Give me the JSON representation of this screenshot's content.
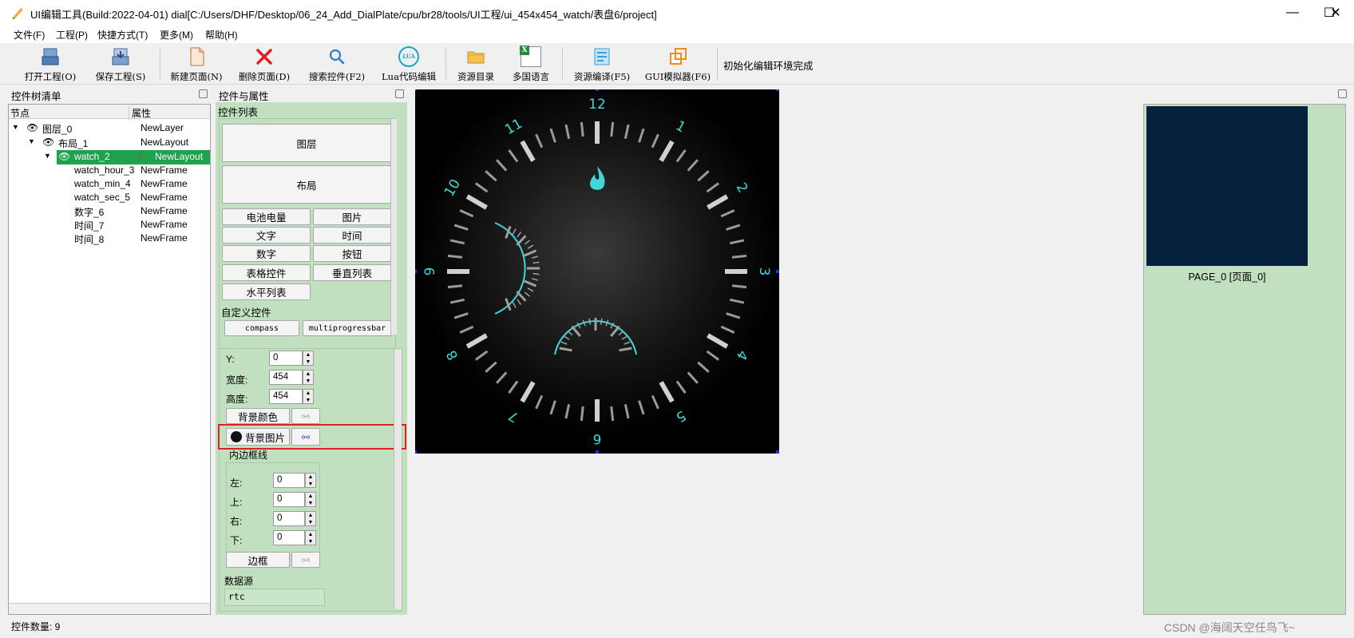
{
  "window": {
    "title": "UI编辑工具(Build:2022-04-01) dial[C:/Users/DHF/Desktop/06_24_Add_DialPlate/cpu/br28/tools/UI工程/ui_454x454_watch/表盘6/project]",
    "minimize": "—",
    "maximize": "☐",
    "close": "✕"
  },
  "menu": [
    "文件(F)",
    "工程(P)",
    "快捷方式(T)",
    "更多(M)",
    "帮助(H)"
  ],
  "toolbar": {
    "open": "打开工程(O)",
    "save": "保存工程(S)",
    "new_page": "新建页面(N)",
    "delete_page": "删除页面(D)",
    "search": "搜索控件(F2)",
    "lua": "Lua代码编辑",
    "res_dir": "资源目录",
    "multi_lang": "多国语言",
    "res_compile": "资源编译(F5)",
    "gui_sim": "GUI模拟器(F6)",
    "status": "初始化编辑环境完成",
    "lua_badge": "LUA",
    "excel_badge": "X"
  },
  "tree": {
    "title": "控件树清单",
    "col_node": "节点",
    "col_attr": "属性",
    "rows": [
      {
        "name": "图层_0",
        "attr": "NewLayer"
      },
      {
        "name": "布局_1",
        "attr": "NewLayout"
      },
      {
        "name": "watch_2",
        "attr": "NewLayout"
      },
      {
        "name": "watch_hour_3",
        "attr": "NewFrame"
      },
      {
        "name": "watch_min_4",
        "attr": "NewFrame"
      },
      {
        "name": "watch_sec_5",
        "attr": "NewFrame"
      },
      {
        "name": "数字_6",
        "attr": "NewFrame"
      },
      {
        "name": "时间_7",
        "attr": "NewFrame"
      },
      {
        "name": "时间_8",
        "attr": "NewFrame"
      }
    ]
  },
  "props": {
    "title": "控件与属性",
    "list_title": "控件列表",
    "btn_layer": "图层",
    "btn_layout": "布局",
    "grid": [
      "电池电量",
      "图片",
      "文字",
      "时间",
      "数字",
      "按钮",
      "表格控件",
      "垂直列表",
      "水平列表"
    ],
    "custom_title": "自定义控件",
    "custom_items": [
      "compass",
      "multiprogressbar"
    ],
    "y_label": "Y:",
    "y_val": "0",
    "w_label": "宽度:",
    "w_val": "454",
    "h_label": "高度:",
    "h_val": "454",
    "bg_color": "背景颜色",
    "bg_image": "背景图片",
    "padding_title": "内边框线",
    "left_label": "左:",
    "left_val": "0",
    "top_label": "上:",
    "top_val": "0",
    "right_label": "右:",
    "right_val": "0",
    "bottom_label": "下:",
    "bottom_val": "0",
    "border_btn": "边框",
    "datasource_title": "数据源",
    "datasource_val": "rtc"
  },
  "watch": {
    "numbers": [
      "12",
      "1",
      "2",
      "3",
      "4",
      "5",
      "6",
      "7",
      "8",
      "9",
      "10",
      "11"
    ],
    "accent": "#40d8d8"
  },
  "preview": {
    "page_label": "PAGE_0 [页面_0]",
    "bg": "#06213d"
  },
  "status": {
    "count": "控件数量: 9",
    "watermark": "CSDN @海阔天空任鸟飞~"
  }
}
